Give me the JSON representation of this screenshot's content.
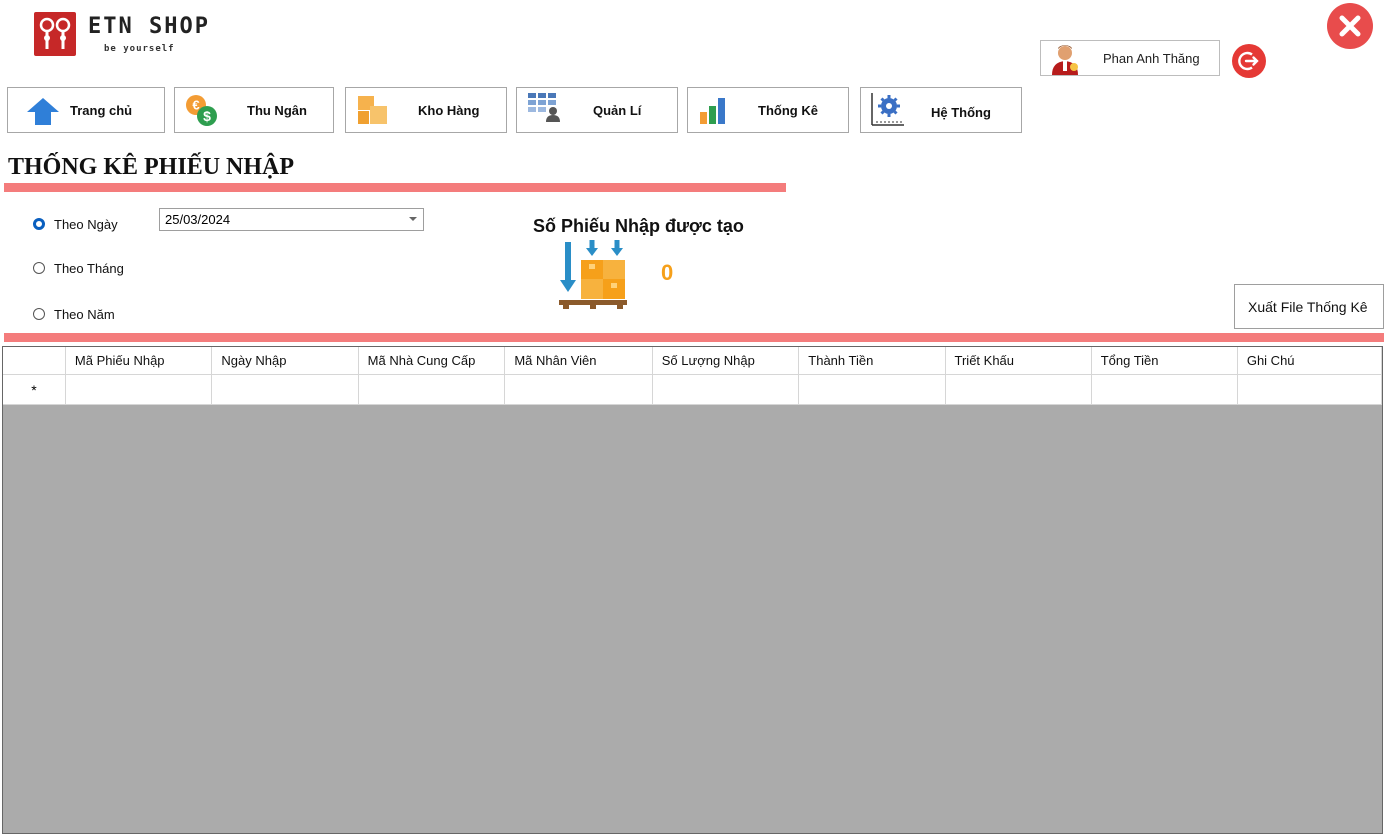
{
  "brand": {
    "name": "ETN SHOP",
    "tagline": "be yourself"
  },
  "user": {
    "name": "Phan Anh Thăng"
  },
  "nav": [
    {
      "label": "Trang chủ",
      "icon": "home-icon"
    },
    {
      "label": "Thu Ngân",
      "icon": "cashier-icon"
    },
    {
      "label": "Kho Hàng",
      "icon": "warehouse-icon"
    },
    {
      "label": "Quản Lí",
      "icon": "manage-icon"
    },
    {
      "label": "Thống Kê",
      "icon": "statistics-icon"
    },
    {
      "label": "Hệ Thống",
      "icon": "system-icon"
    }
  ],
  "page": {
    "title": "THỐNG KÊ PHIẾU NHẬP"
  },
  "filter": {
    "options": [
      "Theo Ngày",
      "Theo Tháng",
      "Theo Năm"
    ],
    "selected": "Theo Ngày",
    "date_value": "25/03/2024"
  },
  "stat": {
    "label": "Số Phiếu Nhập được tạo",
    "value": "0"
  },
  "export": {
    "label": "Xuất File Thống Kê"
  },
  "grid": {
    "columns": [
      "Mã Phiếu Nhập",
      "Ngày Nhập",
      "Mã Nhà Cung Cấp",
      "Mã Nhân Viên",
      "Số Lượng Nhập",
      "Thành Tiền",
      "Triết Khấu",
      "Tổng Tiền",
      "Ghi Chú"
    ],
    "new_row_marker": "*",
    "rows": []
  },
  "colors": {
    "accent_bar": "#f47c7c",
    "close": "#e84c4c",
    "stat_value": "#f6a01a",
    "radio_selected": "#0a5fbf",
    "grid_empty": "#ababab"
  }
}
